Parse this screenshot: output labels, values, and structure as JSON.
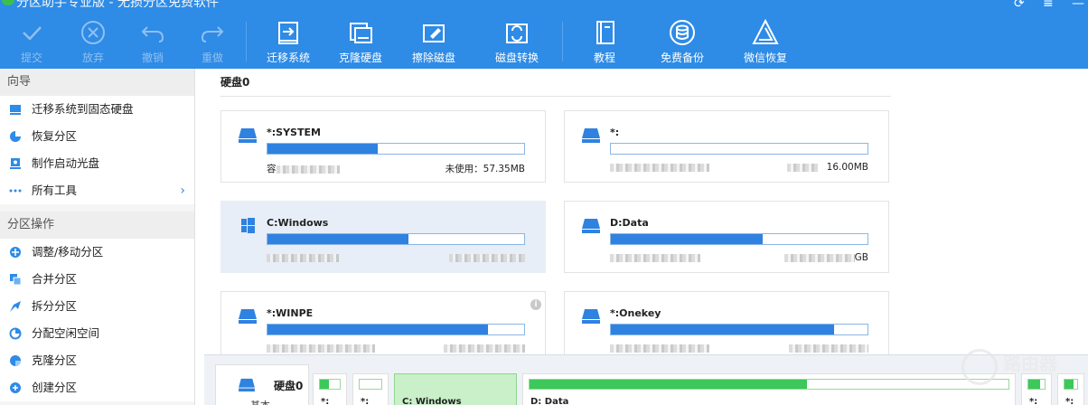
{
  "window": {
    "title": "分区助手专业版 - 无损分区免费软件",
    "controls": {
      "refresh_icon": "refresh-icon",
      "menu_icon": "menu-icon",
      "minimize_icon": "minimize-icon"
    }
  },
  "toolbar": {
    "accent": "#2e8be6",
    "buttons": [
      {
        "label": "提交",
        "icon": "check-icon",
        "enabled": false
      },
      {
        "label": "放弃",
        "icon": "cancel-icon",
        "enabled": false
      },
      {
        "label": "撤销",
        "icon": "undo-icon",
        "enabled": false
      },
      {
        "label": "重做",
        "icon": "redo-icon",
        "enabled": false
      },
      {
        "label": "迁移系统",
        "icon": "migrate-system-icon",
        "enabled": true
      },
      {
        "label": "克隆硬盘",
        "icon": "clone-disk-icon",
        "enabled": true
      },
      {
        "label": "擦除磁盘",
        "icon": "wipe-disk-icon",
        "enabled": true
      },
      {
        "label": "磁盘转换",
        "icon": "disk-convert-icon",
        "enabled": true
      },
      {
        "label": "教程",
        "icon": "tutorial-icon",
        "enabled": true
      },
      {
        "label": "免费备份",
        "icon": "backup-icon",
        "enabled": true
      },
      {
        "label": "微信恢复",
        "icon": "wechat-recover-icon",
        "enabled": true
      }
    ]
  },
  "sidebar": {
    "wizard": {
      "title": "向导",
      "items": [
        {
          "label": "迁移系统到固态硬盘",
          "icon": "ssd-migrate-icon"
        },
        {
          "label": "恢复分区",
          "icon": "recover-partition-icon"
        },
        {
          "label": "制作启动光盘",
          "icon": "boot-disc-icon"
        },
        {
          "label": "所有工具",
          "icon": "all-tools-icon"
        }
      ]
    },
    "operations": {
      "title": "分区操作",
      "items": [
        {
          "label": "调整/移动分区",
          "icon": "resize-move-icon"
        },
        {
          "label": "合并分区",
          "icon": "merge-icon"
        },
        {
          "label": "拆分分区",
          "icon": "split-icon"
        },
        {
          "label": "分配空闲空间",
          "icon": "allocate-space-icon"
        },
        {
          "label": "克隆分区",
          "icon": "clone-partition-icon"
        },
        {
          "label": "创建分区",
          "icon": "create-partition-icon"
        }
      ]
    }
  },
  "main": {
    "disk_title": "硬盘0",
    "partitions": [
      {
        "name": "*:SYSTEM",
        "usage": 0.43,
        "cap_prefix": "容",
        "free_text": "未使用：57.35MB",
        "icon": "drive-icon"
      },
      {
        "name": "*:",
        "usage": 0.0,
        "cap_prefix": "",
        "free_text": "16.00MB",
        "icon": "drive-icon"
      },
      {
        "name": "C:Windows",
        "usage": 0.55,
        "cap_prefix": "",
        "free_text": "",
        "icon": "windows-icon",
        "selected": true
      },
      {
        "name": "D:Data",
        "usage": 0.59,
        "cap_prefix": "",
        "free_text": "GB",
        "icon": "drive-icon"
      },
      {
        "name": "*:WINPE",
        "usage": 0.86,
        "cap_prefix": "",
        "free_text": "",
        "icon": "drive-icon"
      },
      {
        "name": "*:Onekey",
        "usage": 0.87,
        "cap_prefix": "",
        "free_text": "",
        "icon": "drive-icon"
      }
    ]
  },
  "diskmap": {
    "disk_label": "硬盘0",
    "disk_sub": "基本",
    "parts": [
      {
        "label": "*:",
        "usage": 0.45
      },
      {
        "label": "*:",
        "usage": 0.0
      },
      {
        "label": "C: Windows",
        "usage": 0.0,
        "selected": true
      },
      {
        "label": "D: Data",
        "usage": 0.58
      },
      {
        "label": "*:",
        "usage": 0.7
      },
      {
        "label": "*:",
        "usage": 0.7
      }
    ]
  },
  "watermark": {
    "text": "路由器"
  }
}
